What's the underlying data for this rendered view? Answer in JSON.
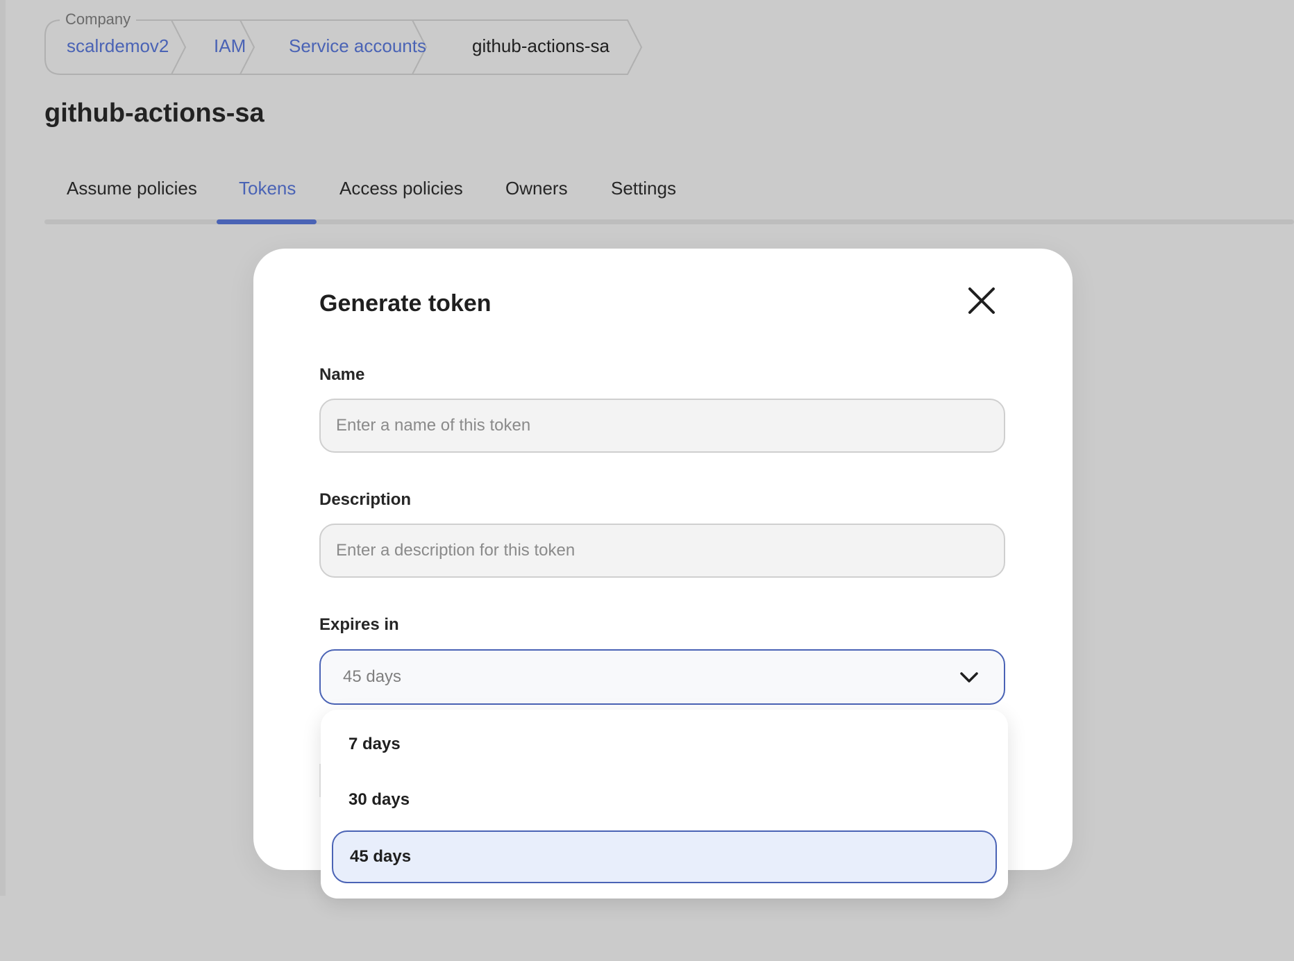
{
  "breadcrumb": {
    "legend": "Company",
    "items": [
      {
        "label": "scalrdemov2"
      },
      {
        "label": "IAM"
      },
      {
        "label": "Service accounts"
      },
      {
        "label": "github-actions-sa"
      }
    ]
  },
  "page": {
    "title": "github-actions-sa"
  },
  "tabs": [
    {
      "label": "Assume policies",
      "active": false
    },
    {
      "label": "Tokens",
      "active": true
    },
    {
      "label": "Access policies",
      "active": false
    },
    {
      "label": "Owners",
      "active": false
    },
    {
      "label": "Settings",
      "active": false
    }
  ],
  "modal": {
    "title": "Generate token",
    "close_icon": "close-icon",
    "name_field": {
      "label": "Name",
      "placeholder": "Enter a name of this token",
      "value": ""
    },
    "description_field": {
      "label": "Description",
      "placeholder": "Enter a description for this token",
      "value": ""
    },
    "expires_field": {
      "label": "Expires in",
      "value": "45 days",
      "chevron_icon": "chevron-down-icon",
      "options": [
        {
          "label": "7 days",
          "selected": false
        },
        {
          "label": "30 days",
          "selected": false
        },
        {
          "label": "45 days",
          "selected": true
        }
      ]
    }
  },
  "colors": {
    "accent": "#4a63b5",
    "backdrop": "#cbcbcb",
    "selected_option_bg": "#e8eefb"
  }
}
